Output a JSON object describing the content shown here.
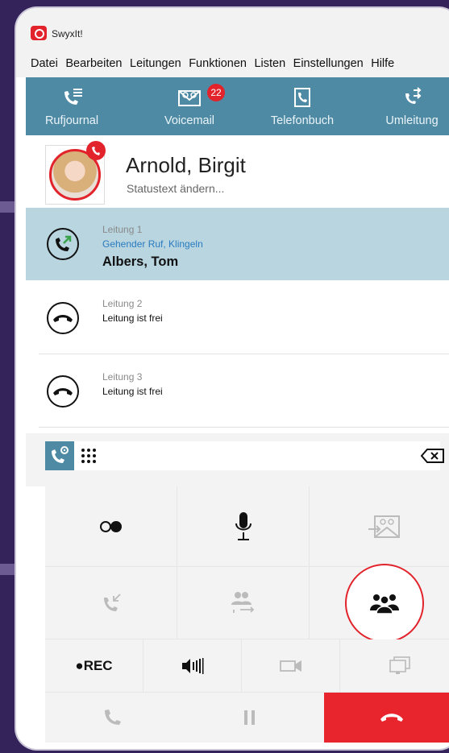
{
  "app": {
    "title": "SwyxIt!"
  },
  "menu": [
    "Datei",
    "Bearbeiten",
    "Leitungen",
    "Funktionen",
    "Listen",
    "Einstellungen",
    "Hilfe"
  ],
  "toolbar": {
    "items": [
      {
        "label": "Rufjournal",
        "icon": "call-journal-icon"
      },
      {
        "label": "Voicemail",
        "icon": "voicemail-icon",
        "badge": "22"
      },
      {
        "label": "Telefonbuch",
        "icon": "phonebook-icon"
      },
      {
        "label": "Umleitung",
        "icon": "call-forward-icon"
      }
    ]
  },
  "profile": {
    "name": "Arnold, Birgit",
    "status": "Statustext ändern..."
  },
  "lines": [
    {
      "title": "Leitung 1",
      "state": "Gehender Ruf, Klingeln",
      "caller": "Albers, Tom",
      "active": true
    },
    {
      "title": "Leitung 2",
      "state": "Leitung ist frei",
      "caller": "",
      "active": false
    },
    {
      "title": "Leitung 3",
      "state": "Leitung ist frei",
      "caller": "",
      "active": false
    }
  ],
  "controls": {
    "rec_label": "REC"
  },
  "colors": {
    "accent": "#4f8aa5",
    "active_line": "#b8d5e0",
    "red": "#e2232b",
    "background": "#33235a"
  }
}
